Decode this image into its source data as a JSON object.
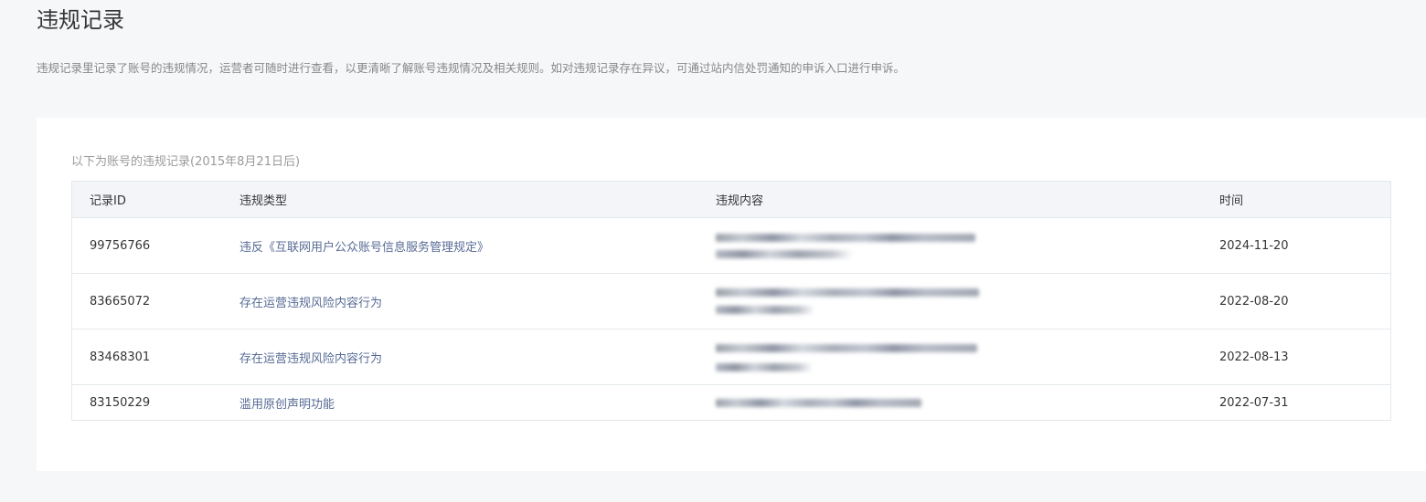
{
  "page": {
    "title": "违规记录",
    "description": "违规记录里记录了账号的违规情况，运营者可随时进行查看，以更清晰了解账号违规情况及相关规则。如对违规记录存在异议，可通过站内信处罚通知的申诉入口进行申诉。"
  },
  "table": {
    "caption": "以下为账号的违规记录(2015年8月21日后)",
    "columns": {
      "id": "记录ID",
      "type": "违规类型",
      "content": "违规内容",
      "time": "时间"
    },
    "rows": [
      {
        "id": "99756766",
        "type": "违反《互联网用户公众账号信息服务管理规定》",
        "time": "2024-11-20"
      },
      {
        "id": "83665072",
        "type": "存在运营违规风险内容行为",
        "time": "2022-08-20"
      },
      {
        "id": "83468301",
        "type": "存在运营违规风险内容行为",
        "time": "2022-08-13"
      },
      {
        "id": "83150229",
        "type": "滥用原创声明功能",
        "time": "2022-07-31"
      }
    ]
  },
  "colors": {
    "page_bg": "#f6f7f9",
    "panel_bg": "#ffffff",
    "header_bg": "#f4f5f9",
    "border": "#e4e8eb",
    "link_text": "#576b95",
    "muted_text": "#888888"
  }
}
